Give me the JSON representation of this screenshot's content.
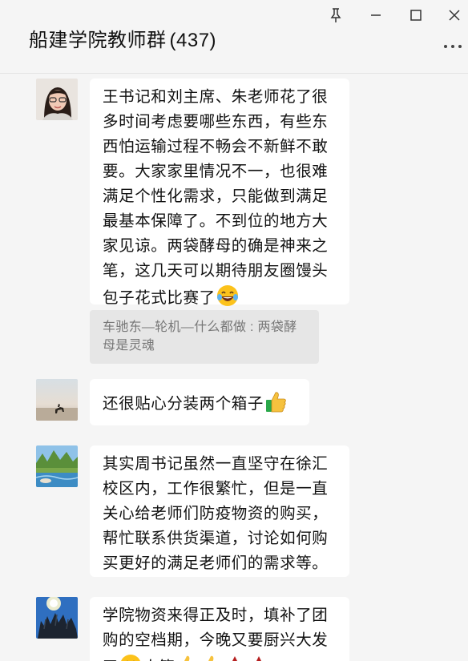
{
  "window": {
    "title": "船建学院教师群",
    "member_count": "(437)"
  },
  "messages": [
    {
      "avatar": "woman-with-glasses-avatar",
      "text": "王书记和刘主席、朱老师花了很多时间考虑要哪些东西，有些东西怕运输过程不畅会不新鲜不敢要。大家家里情况不一，也很难满足个性化需求，只能做到满足最基本保障了。不到位的地方大家见谅。两袋酵母的确是神来之笔，这几天可以期待朋友圈馒头包子花式比赛了",
      "emoji": "tears-of-joy-emoji",
      "quote": "车驰东—轮机—什么都做 : 两袋酵母是灵魂"
    },
    {
      "avatar": "beach-horse-avatar",
      "text": "还很贴心分装两个箱子",
      "emoji": "thumbs-up-emoji"
    },
    {
      "avatar": "landscape-avatar",
      "text": "其实周书记虽然一直坚守在徐汇校区内，工作很繁忙，但是一直关心给老师们防疫物资的购买，帮忙联系供货渠道，讨论如何购买更好的满足老师们的需求等。"
    },
    {
      "avatar": "sun-tree-avatar",
      "text": "学院物资来得正及时，填补了团购的空档期，今晚又要厨兴大发了",
      "trailing_text": "人等"
    }
  ],
  "colors": {
    "bubble": "#ffffff",
    "background": "#f5f5f5",
    "quote_bg": "#e6e6e6"
  }
}
